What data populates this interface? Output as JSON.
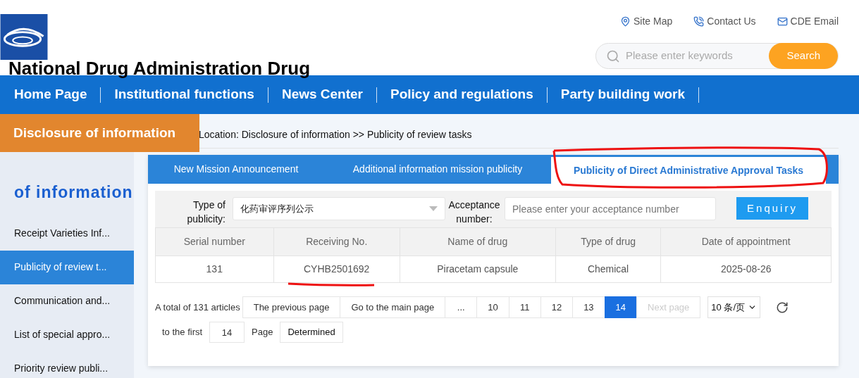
{
  "header": {
    "site_title": "National Drug Administration Drug",
    "links": [
      {
        "kind": "map",
        "label": "Site Map"
      },
      {
        "kind": "phone",
        "label": "Contact Us"
      },
      {
        "kind": "mail",
        "label": "CDE Email"
      }
    ],
    "search": {
      "placeholder": "Please enter keywords",
      "button": "Search"
    }
  },
  "nav": [
    "Home Page",
    "Institutional functions",
    "News Center",
    "Policy and regulations",
    "Party building work"
  ],
  "sidebar": {
    "banner": "Disclosure of information",
    "heading": "of information",
    "items": [
      {
        "label": "Receipt Varieties Inf...",
        "selected": false
      },
      {
        "label": "Publicity of review t...",
        "selected": true
      },
      {
        "label": "Communication and...",
        "selected": false
      },
      {
        "label": "List of special appro...",
        "selected": false
      },
      {
        "label": "Priority review publi...",
        "selected": false
      }
    ]
  },
  "breadcrumb": "Location: Disclosure of information >> Publicity of review tasks",
  "tabs": [
    {
      "label": "New Mission Announcement",
      "selected": false
    },
    {
      "label": "Additional information mission publicity",
      "selected": false
    },
    {
      "label": "Publicity of Direct Administrative Approval Tasks",
      "selected": true
    }
  ],
  "filter": {
    "type_label": "Type of publicity:",
    "type_value": "化药审评序列公示",
    "number_label": "Acceptance number:",
    "number_placeholder": "Please enter your acceptance number",
    "button": "Enquiry"
  },
  "table": {
    "columns": [
      "Serial number",
      "Receiving No.",
      "Name of drug",
      "Type of drug",
      "Date of appointment"
    ],
    "rows": [
      [
        "131",
        "CYHB2501692",
        "Piracetam capsule",
        "Chemical",
        "2025-08-26"
      ]
    ]
  },
  "pagination": {
    "total": "A total of 131 articles",
    "buttons": [
      {
        "label": "The previous page",
        "selected": false,
        "disabled": false
      },
      {
        "label": "Go to the main page",
        "selected": false,
        "disabled": false
      },
      {
        "label": "...",
        "selected": false,
        "disabled": false
      },
      {
        "label": "10",
        "selected": false,
        "disabled": false
      },
      {
        "label": "11",
        "selected": false,
        "disabled": false
      },
      {
        "label": "12",
        "selected": false,
        "disabled": false
      },
      {
        "label": "13",
        "selected": false,
        "disabled": false
      },
      {
        "label": "14",
        "selected": true,
        "disabled": false
      },
      {
        "label": "Next page",
        "selected": false,
        "disabled": true
      }
    ],
    "page_size": "10 条/页",
    "goto_prefix": "to the first",
    "goto_value": "14",
    "goto_suffix": "Page",
    "goto_button": "Determined"
  }
}
